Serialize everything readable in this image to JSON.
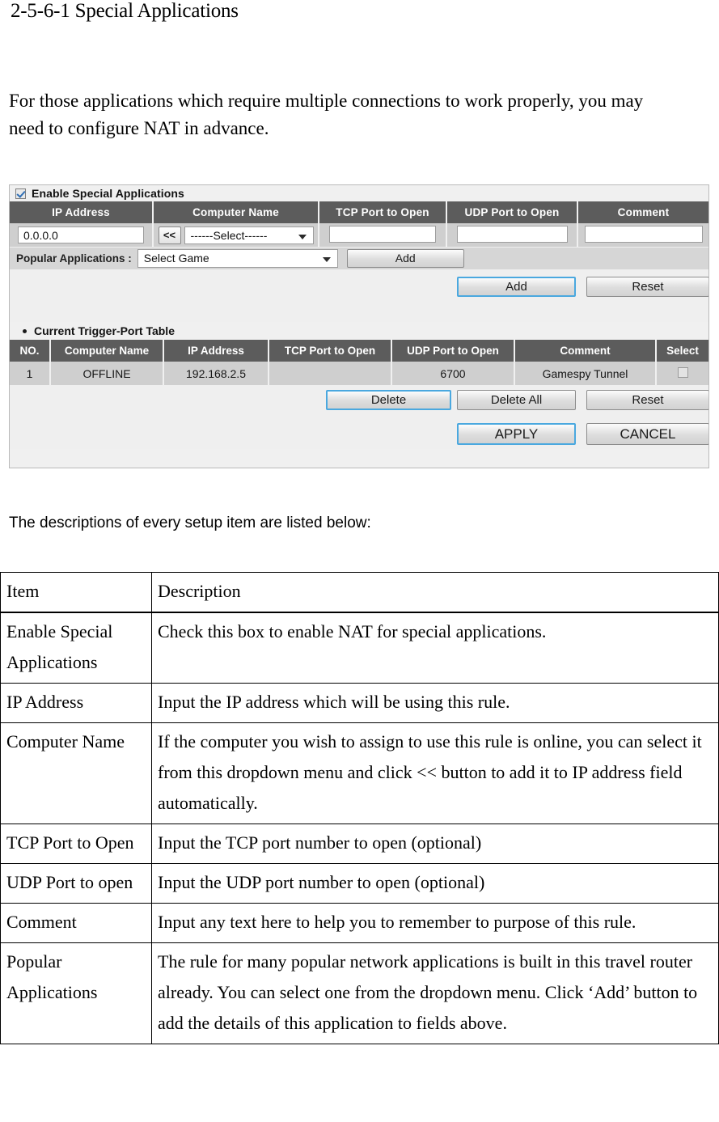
{
  "document": {
    "heading": "2-5-6-1 Special Applications",
    "intro": "For those applications which require multiple connections to work properly, you may need to configure NAT in advance.",
    "table_intro": "The descriptions of every setup item are listed below:"
  },
  "ui": {
    "enable_checkbox_label": "Enable Special Applications",
    "enable_checkbox_checked": true,
    "entry_table": {
      "headers": [
        "IP Address",
        "Computer Name",
        "TCP Port to Open",
        "UDP Port to Open",
        "Comment"
      ],
      "ip_address_value": "0.0.0.0",
      "copy_button_label": "<<",
      "computer_name_select": "------Select------",
      "tcp_port_value": "",
      "udp_port_value": "",
      "comment_value": ""
    },
    "popular": {
      "label": "Popular Applications :",
      "select_value": "Select Game",
      "add_label": "Add"
    },
    "entry_actions": {
      "add_label": "Add",
      "reset_label": "Reset"
    },
    "trigger_section": {
      "title": "Current Trigger-Port Table",
      "headers": [
        "NO.",
        "Computer Name",
        "IP Address",
        "TCP Port to Open",
        "UDP Port to Open",
        "Comment",
        "Select"
      ],
      "rows": [
        {
          "no": "1",
          "computer_name": "OFFLINE",
          "ip_address": "192.168.2.5",
          "tcp_port": "",
          "udp_port": "6700",
          "comment": "Gamespy Tunnel",
          "selected": false
        }
      ],
      "actions": {
        "delete_label": "Delete",
        "delete_all_label": "Delete All",
        "reset_label": "Reset"
      }
    },
    "footer_actions": {
      "apply_label": "APPLY",
      "cancel_label": "CANCEL"
    },
    "colors": {
      "header_bg": "#5c5c5c",
      "row_bg": "#cfcfcf",
      "panel_bg": "#f0f0f0",
      "focus_outline": "#4aa8df"
    }
  },
  "descriptions": {
    "headers": [
      "Item",
      "Description"
    ],
    "rows": [
      {
        "item": "Enable Special Applications",
        "description": "Check this box to enable NAT for special applications."
      },
      {
        "item": "IP Address",
        "description": "Input the IP address which will be using this rule."
      },
      {
        "item": "Computer Name",
        "description": "If the computer you wish to assign to use this rule is online, you can select it from this dropdown menu and click << button to add it to IP address field automatically."
      },
      {
        "item": "TCP Port to Open",
        "description": "Input the TCP port number to open (optional)"
      },
      {
        "item": "UDP Port to open",
        "description": "Input the UDP port number to open (optional)"
      },
      {
        "item": "Comment",
        "description": "Input any text here to help you to remember to purpose of this rule."
      },
      {
        "item": "Popular Applications",
        "description": "The rule for many popular network applications is built in this travel router already. You can select one from the dropdown menu. Click ‘Add’ button to add the details of this application to fields above."
      }
    ]
  }
}
